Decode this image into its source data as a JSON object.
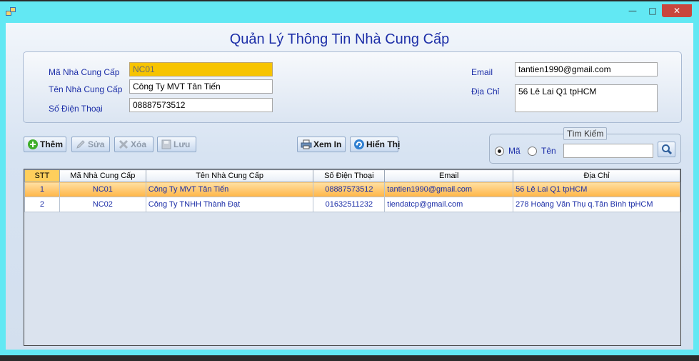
{
  "window": {
    "minimize": "—",
    "maximize": "□",
    "close": "✕"
  },
  "title": "Quản Lý Thông Tin  Nhà Cung Cấp",
  "form": {
    "ma_label": "Mã Nhà Cung Cấp",
    "ma_value": "NC01",
    "ten_label": "Tên Nhà Cung Cấp",
    "ten_value": "Công Ty MVT Tân Tiến",
    "sdt_label": "Số Điện Thoại",
    "sdt_value": "08887573512",
    "email_label": "Email",
    "email_value": "tantien1990@gmail.com",
    "diachi_label": "Địa Chỉ",
    "diachi_value": "56 Lê Lai Q1 tpHCM"
  },
  "toolbar": {
    "them": "Thêm",
    "sua": "Sửa",
    "xoa": "Xóa",
    "luu": "Lưu",
    "xemin": "Xem In",
    "hienthi": "Hiển Thị"
  },
  "search": {
    "legend": "Tìm Kiếm",
    "opt_ma": "Mã",
    "opt_ten": "Tên",
    "selected": "Mã",
    "query": ""
  },
  "grid": {
    "columns": [
      "STT",
      "Mã Nhà Cung Cấp",
      "Tên Nhà Cung Cấp",
      "Số Điện Thoại",
      "Email",
      "Địa Chỉ"
    ],
    "rows": [
      [
        "1",
        "NC01",
        "Công Ty MVT Tân Tiến",
        "08887573512",
        "tantien1990@gmail.com",
        "56 Lê Lai Q1 tpHCM"
      ],
      [
        "2",
        "NC02",
        "Công Ty TNHH Thành Đạt",
        "01632511232",
        "tiendatcp@gmail.com",
        "278 Hoàng Văn Thụ q.Tân Bình tpHCM"
      ]
    ],
    "selected_row": 1
  },
  "colors": {
    "frame": "#62e8f3",
    "label_blue": "#1d2fa8",
    "readonly_yellow": "#f7c400",
    "row_highlight": "#ffb546"
  }
}
